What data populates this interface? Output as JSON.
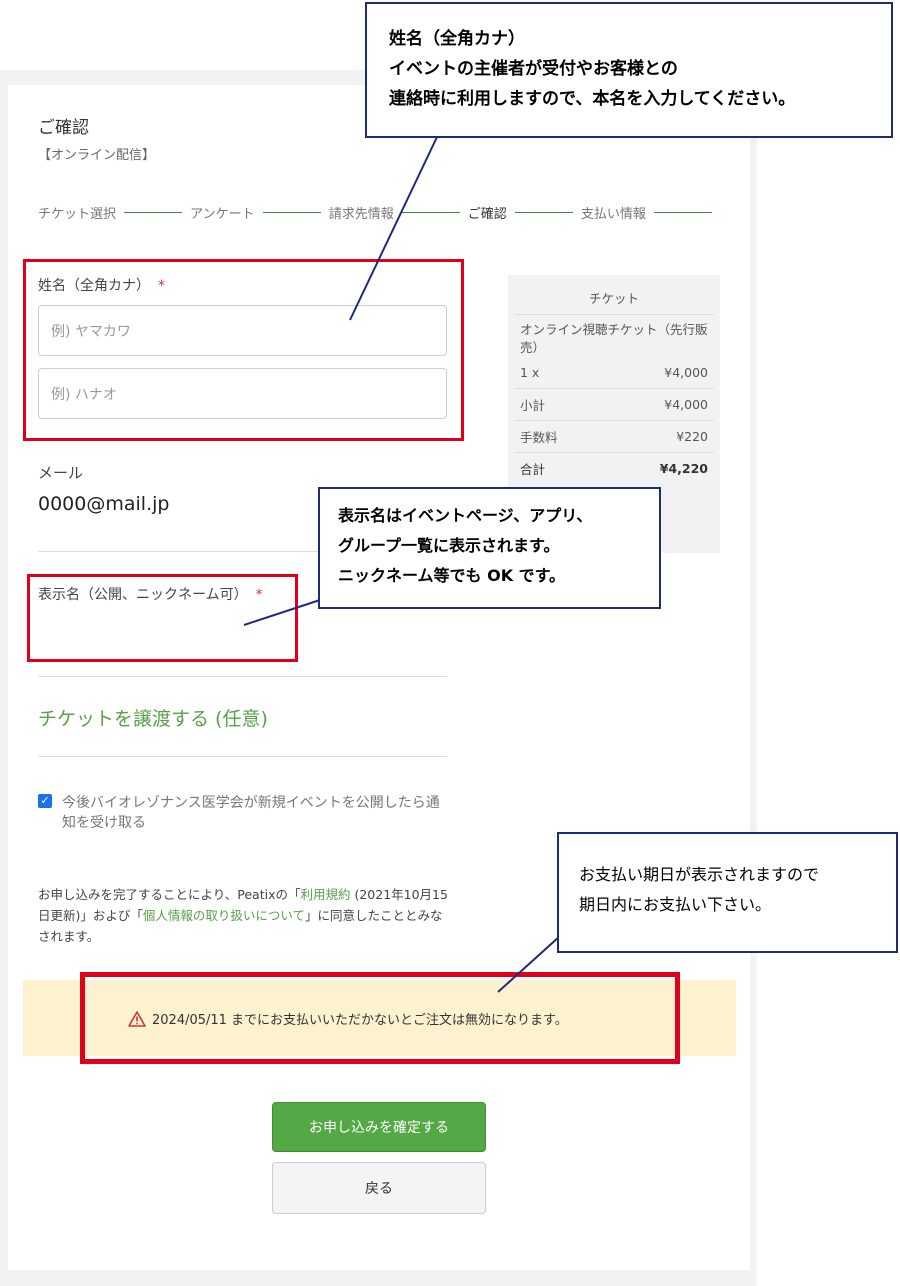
{
  "header": {
    "title": "ご確認",
    "subtitle": "【オンライン配信】"
  },
  "steps": [
    {
      "label": "チケット選択"
    },
    {
      "label": "アンケート"
    },
    {
      "label": "請求先情報"
    },
    {
      "label": "ご確認"
    },
    {
      "label": "支払い情報"
    }
  ],
  "name_section": {
    "label": "姓名（全角カナ）",
    "required_mark": "*",
    "last_name_placeholder": "例) ヤマカワ",
    "first_name_placeholder": "例) ハナオ"
  },
  "email": {
    "label": "メール",
    "value": "0000@mail.jp"
  },
  "display_name": {
    "label": "表示名（公開、ニックネーム可）",
    "required_mark": "*"
  },
  "transfer_link": "チケットを譲渡する (任意)",
  "notify": {
    "checked": true,
    "label": "今後バイオレゾナンス医学会が新規イベントを公開したら通知を受け取る"
  },
  "terms": {
    "part1": "お申し込みを完了することにより、Peatixの「",
    "link1": "利用規約",
    "part2": " (2021年10月15日更新)」および「",
    "link2": "個人情報の取り扱いについて",
    "part3": "」に同意したこととみなされます。"
  },
  "warning": {
    "text": "2024/05/11 までにお支払いいただかないとご注文は無効になります。"
  },
  "buttons": {
    "confirm": "お申し込みを確定する",
    "back": "戻る"
  },
  "summary": {
    "header": "チケット",
    "ticket_name": "オンライン視聴チケット（先行販売）",
    "qty": "1 x",
    "qty_price": "¥4,000",
    "subtotal_label": "小計",
    "subtotal": "¥4,000",
    "fee_label": "手数料",
    "fee": "¥220",
    "total_label": "合計",
    "total": "¥4,220"
  },
  "callouts": {
    "name_note": [
      "姓名（全角カナ）",
      "イベントの主催者が受付やお客様との",
      "連絡時に利用しますので、本名を入力してください。"
    ],
    "display_note": [
      "表示名はイベントページ、アプリ、",
      "グループ一覧に表示されます。",
      "ニックネーム等でも OK です。"
    ],
    "payment_note": [
      "お支払い期日が表示されますので",
      "期日内にお支払い下さい。"
    ]
  },
  "colors": {
    "accent_green": "#54a845",
    "highlight_red": "#e0001a",
    "callout_border": "#1f2a78",
    "warning_bg": "#fdf2d0"
  }
}
